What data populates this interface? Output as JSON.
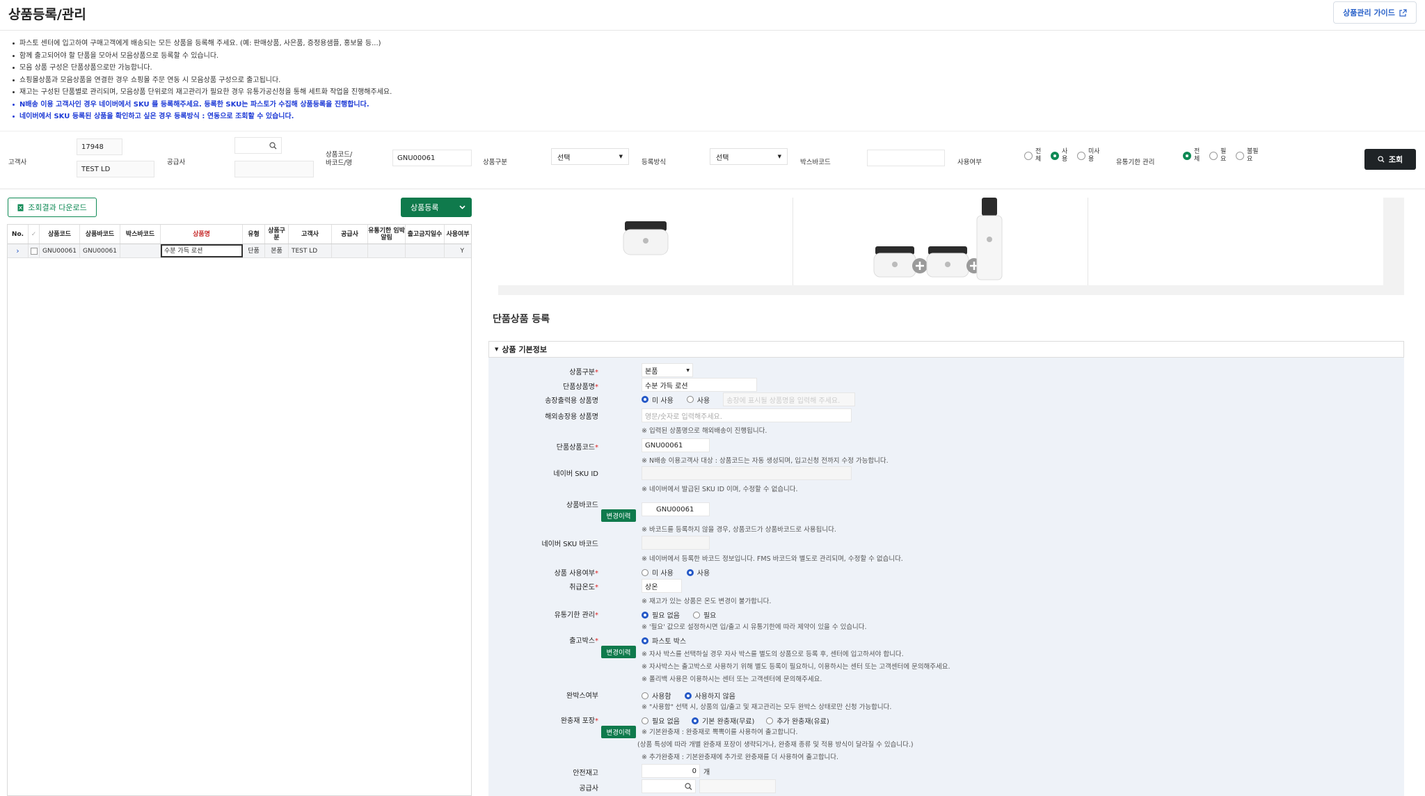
{
  "header": {
    "title": "상품등록/관리",
    "guide_label": "상품관리 가이드"
  },
  "notes": [
    {
      "text": "파스토 센터에 입고하여 구매고객에게 배송되는 모든 상품을 등록해 주세요. (예: 판매상품, 사은품, 증정용샘플, 홍보물 등...)",
      "blue": false
    },
    {
      "text": "함께 출고되어야 할 단품을 모아서 모음상품으로 등록할 수 있습니다.",
      "blue": false
    },
    {
      "text": "모음 상품 구성은 단품상품으로만 가능합니다.",
      "blue": false
    },
    {
      "text": "쇼핑몰상품과 모음상품을 연결한 경우 쇼핑몰 주문 연동 시 모음상품 구성으로 출고됩니다.",
      "blue": false
    },
    {
      "text": "재고는 구성된 단품별로 관리되며, 모음상품 단위로의 재고관리가 필요한 경우 유통가공신청을 통해 세트화 작업을 진행해주세요.",
      "blue": false
    },
    {
      "text": "N배송 이용 고객사인 경우 네이버에서 SKU 를 등록해주세요. 등록한 SKU는 파스토가 수집해 상품등록을 진행합니다.",
      "blue": true
    },
    {
      "text": "네이버에서 SKU 등록된 상품을 확인하고 싶은 경우 등록방식 : 연동으로 조회할 수 있습니다.",
      "blue": true
    }
  ],
  "search": {
    "customer_label": "고객사",
    "customer_code": "17948",
    "customer_name": "TEST LD",
    "supplier_label": "공급사",
    "code_label_1": "상품코드/",
    "code_label_2": "바코드/명",
    "code_value": "GNU00061",
    "type_label": "상품구분",
    "type_value": "선택",
    "method_label": "등록방식",
    "method_value": "선택",
    "box_label": "박스바코드",
    "use_label": "사용여부",
    "use_opts": [
      {
        "a": "전",
        "b": "체",
        "on": false
      },
      {
        "a": "사",
        "b": "용",
        "on": true
      },
      {
        "a": "미사",
        "b": "용",
        "on": false
      }
    ],
    "exp_label": "유통기한 관리",
    "exp_opts": [
      {
        "a": "전",
        "b": "체",
        "on": true
      },
      {
        "a": "필",
        "b": "요",
        "on": false
      },
      {
        "a": "불필",
        "b": "요",
        "on": false
      }
    ],
    "query_label": "조회"
  },
  "left": {
    "download_label": "조회결과 다운로드",
    "register_label": "상품등록",
    "columns": [
      "No.",
      "✓",
      "상품코드",
      "상품바코드",
      "박스바코드",
      "상품명",
      "유형",
      "상품구분",
      "고객사",
      "공급사",
      "유통기한 임박 알림",
      "출고금지일수",
      "사용여부"
    ],
    "row": {
      "no": "›",
      "code": "GNU00061",
      "barcode": "GNU00061",
      "box": "",
      "name": "수분 가득 로션",
      "type": "단품",
      "kind": "본품",
      "customer": "TEST LD",
      "supplier": "",
      "exp": "",
      "ban": "",
      "use": "Y"
    }
  },
  "right": {
    "section_title": "단품상품 등록",
    "accordion": "상품 기본정보",
    "f_kind_label": "상품구분",
    "f_kind_value": "본품",
    "f_name_label": "단품상품명",
    "f_name_value": "수분 가득 로션",
    "f_ship_label": "송장출력용 상품명",
    "f_ship_no": "미 사용",
    "f_ship_yes": "사용",
    "f_ship_ph": "송장에 표시될 상품명을 입력해 주세요.",
    "f_intl_label": "해외송장용 상품명",
    "f_intl_ph": "영문/숫자로 입력해주세요.",
    "f_intl_note": "※ 입력된 상품명으로 해외배송이 진행됩니다.",
    "f_code_label": "단품상품코드",
    "f_code_value": "GNU00061",
    "f_code_note": "※ N배송 이용고객사 대상 : 상품코드는 자동 생성되며, 입고신청 전까지 수정 가능합니다.",
    "f_sku_label": "네이버 SKU ID",
    "f_sku_note": "※ 네이버에서 발급된 SKU ID 이며, 수정할 수 없습니다.",
    "f_bar_label": "상품바코드",
    "f_bar_btn": "변경이력",
    "f_bar_value": "GNU00061",
    "f_bar_note": "※ 바코드를 등록하지 않을 경우, 상품코드가 상품바코드로 사용됩니다.",
    "f_nbar_label": "네이버 SKU 바코드",
    "f_nbar_note": "※ 네이버에서 등록한 바코드 정보입니다. FMS 바코드와 별도로 관리되며, 수정할 수 없습니다.",
    "f_use_label": "상품 사용여부",
    "f_use_no": "미 사용",
    "f_use_yes": "사용",
    "f_temp_label": "취급온도",
    "f_temp_value": "상온",
    "f_temp_note": "※ 재고가 있는 상품은 온도 변경이 불가합니다.",
    "f_exp_label": "유통기한 관리",
    "f_exp_no": "필요 없음",
    "f_exp_yes": "필요",
    "f_exp_note": "※ '필요' 값으로 설정하시면 입/출고 시 유통기한에 따라 제약이 있을 수 있습니다.",
    "f_box_label": "출고박스",
    "f_box_btn": "변경이력",
    "f_box_value": "파스토 박스",
    "f_box_note1": "※ 자사 박스를 선택하실 경우 자사 박스를 별도의 상품으로 등록 후, 센터에 입고하셔야 합니다.",
    "f_box_note2": "※ 자사박스는 출고박스로 사용하기 위해 별도 등록이 필요하니, 이용하시는 센터 또는 고객센터에 문의해주세요.",
    "f_box_note3": "※ 폴리백 사용은 이용하시는 센터 또는 고객센터에 문의해주세요.",
    "f_full_label": "완박스여부",
    "f_full_yes": "사용함",
    "f_full_no": "사용하지 않음",
    "f_full_note": "※ \"사용함\" 선택 시, 상품의 입/출고 및 재고관리는 모두 완박스 상태로만 신청 가능합니다.",
    "f_pack_label": "완충재 포장",
    "f_pack_btn": "변경이력",
    "f_pack_o1": "필요 없음",
    "f_pack_o2": "기본 완충재(무료)",
    "f_pack_o3": "추가 완충재(유료)",
    "f_pack_note1": "※ 기본완충재 : 완충재로 뽁뽁이를 사용하여 출고합니다.",
    "f_pack_note2": "(상품 특성에 따라 개별 완충재 포장이 생략되거나, 완충재 종류 및 적용 방식이 달라질 수 있습니다.)",
    "f_pack_note3": "※ 추가완충재 : 기본완충재에 추가로 완충재를 더 사용하여 출고합니다.",
    "f_safe_label": "안전재고",
    "f_safe_value": "0",
    "f_safe_unit": "개",
    "f_sup_label": "공급사"
  },
  "colors": {
    "green": "#0f7a4c",
    "blue": "#1e3bd6",
    "dark": "#1f2326"
  }
}
